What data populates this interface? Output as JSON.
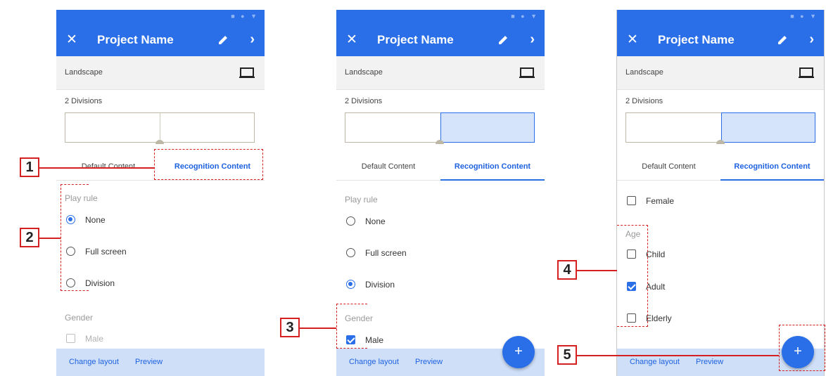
{
  "status_icons": "■ ● ▼",
  "screens": [
    {
      "appbar": {
        "close_icon": "✕",
        "title": "Project Name",
        "next_icon": "›"
      },
      "orientation": "Landscape",
      "divisions": "2 Divisions",
      "tabs": [
        "Default Content",
        "Recognition Content"
      ],
      "play_rule": {
        "title": "Play rule",
        "options": [
          "None",
          "Full screen",
          "Division"
        ],
        "selected": "None"
      },
      "gender": {
        "title": "Gender",
        "options": [
          {
            "label": "Male",
            "checked": false
          }
        ]
      },
      "bottom": {
        "change_layout": "Change layout",
        "preview": "Preview"
      }
    },
    {
      "appbar": {
        "close_icon": "✕",
        "title": "Project Name",
        "next_icon": "›"
      },
      "orientation": "Landscape",
      "divisions": "2 Divisions",
      "tabs": [
        "Default Content",
        "Recognition Content"
      ],
      "play_rule": {
        "title": "Play rule",
        "options": [
          "None",
          "Full screen",
          "Division"
        ],
        "selected": "Division"
      },
      "gender": {
        "title": "Gender",
        "options": [
          {
            "label": "Male",
            "checked": true
          }
        ]
      },
      "bottom": {
        "change_layout": "Change layout",
        "preview": "Preview"
      },
      "fab": "+"
    },
    {
      "appbar": {
        "close_icon": "✕",
        "title": "Project Name",
        "next_icon": "›"
      },
      "orientation": "Landscape",
      "divisions": "2 Divisions",
      "tabs": [
        "Default Content",
        "Recognition Content"
      ],
      "gender": {
        "options": [
          {
            "label": "Female",
            "checked": false
          }
        ]
      },
      "age": {
        "title": "Age",
        "options": [
          {
            "label": "Child",
            "checked": false
          },
          {
            "label": "Adult",
            "checked": true
          },
          {
            "label": "Elderly",
            "checked": false
          }
        ]
      },
      "bottom": {
        "change_layout": "Change layout",
        "preview": "Preview"
      },
      "fab": "+"
    }
  ],
  "callouts": [
    "1",
    "2",
    "3",
    "4",
    "5"
  ],
  "colors": {
    "primary": "#2a6fe8",
    "annotation": "#d42020",
    "bottom_bar": "#cfdff8"
  }
}
